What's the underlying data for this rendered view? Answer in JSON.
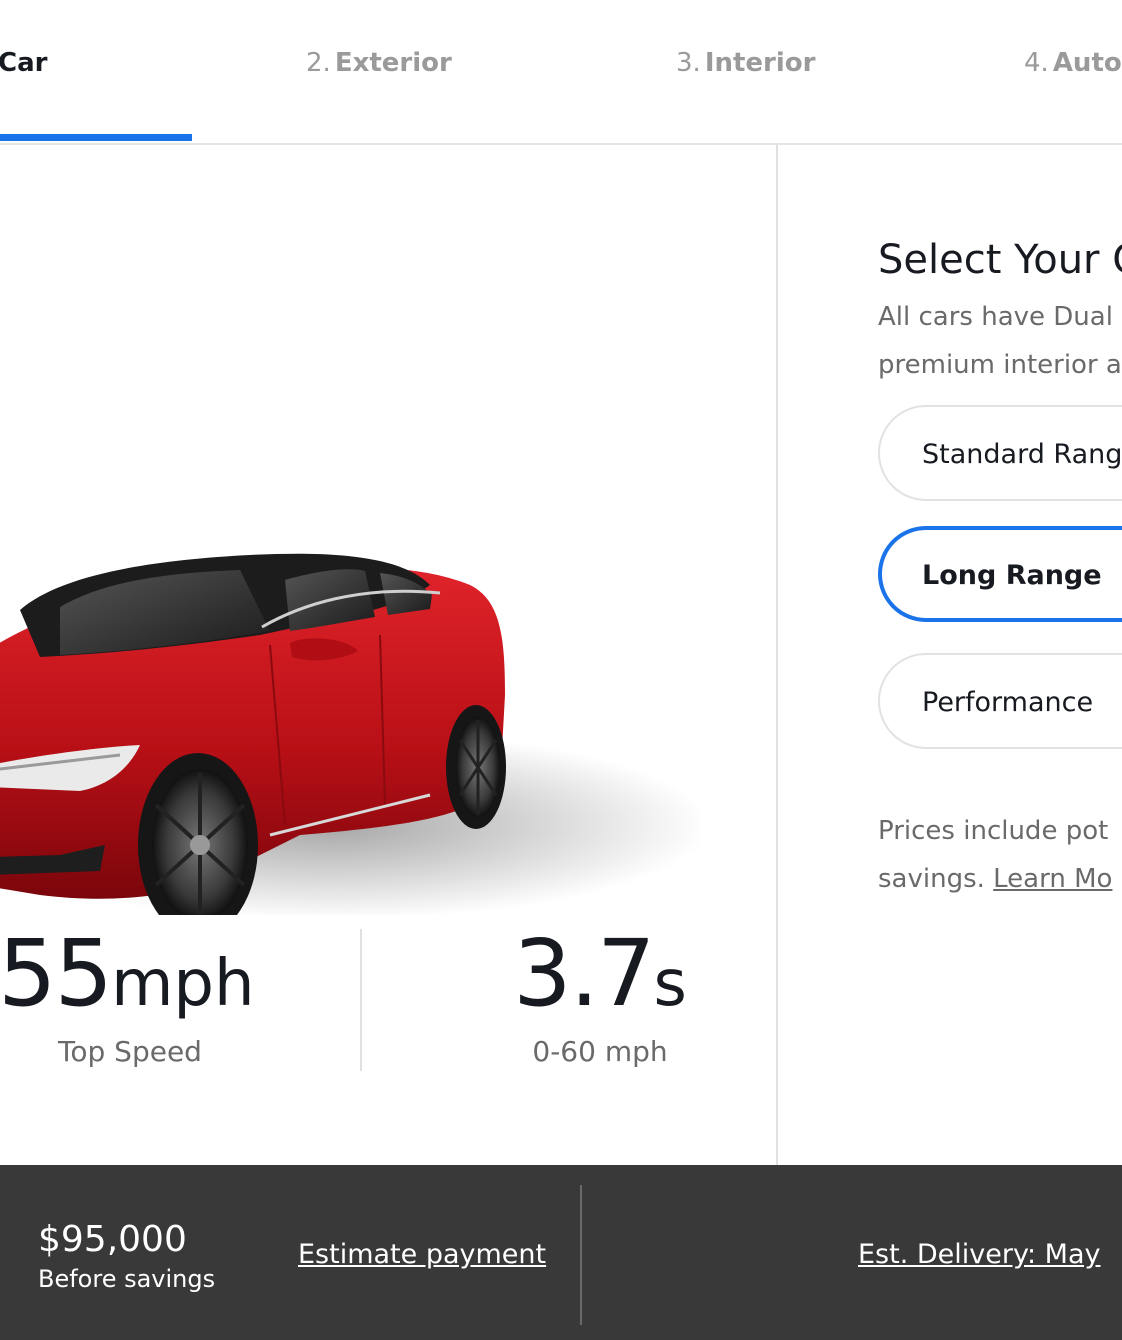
{
  "tabs": [
    {
      "num": "",
      "name": "Car",
      "active": true
    },
    {
      "num": "2.",
      "name": "Exterior"
    },
    {
      "num": "3.",
      "name": "Interior"
    },
    {
      "num": "4.",
      "name": "Auto"
    }
  ],
  "stats": {
    "top_speed_value": "55",
    "top_speed_unit": "mph",
    "top_speed_label": "Top Speed",
    "accel_value": "3.7",
    "accel_unit": "s",
    "accel_label": "0-60 mph"
  },
  "panel": {
    "title": "Select Your C",
    "desc_line1": "All cars have Dual",
    "desc_line2": "premium interior a",
    "options": [
      "Standard Range",
      "Long Range",
      "Performance"
    ],
    "selected_option": "Long Range",
    "note_line1": "Prices include pot",
    "note_line2_prefix": "savings.",
    "learn_more": "Learn Mo"
  },
  "footer": {
    "price": "$95,000",
    "price_label": "Before savings",
    "estimate_payment": "Est​imate payment",
    "delivery": "Est. Delivery: May"
  },
  "colors": {
    "accent": "#1a73e8",
    "car_red": "#c3141a",
    "footer_bg": "#393939"
  }
}
